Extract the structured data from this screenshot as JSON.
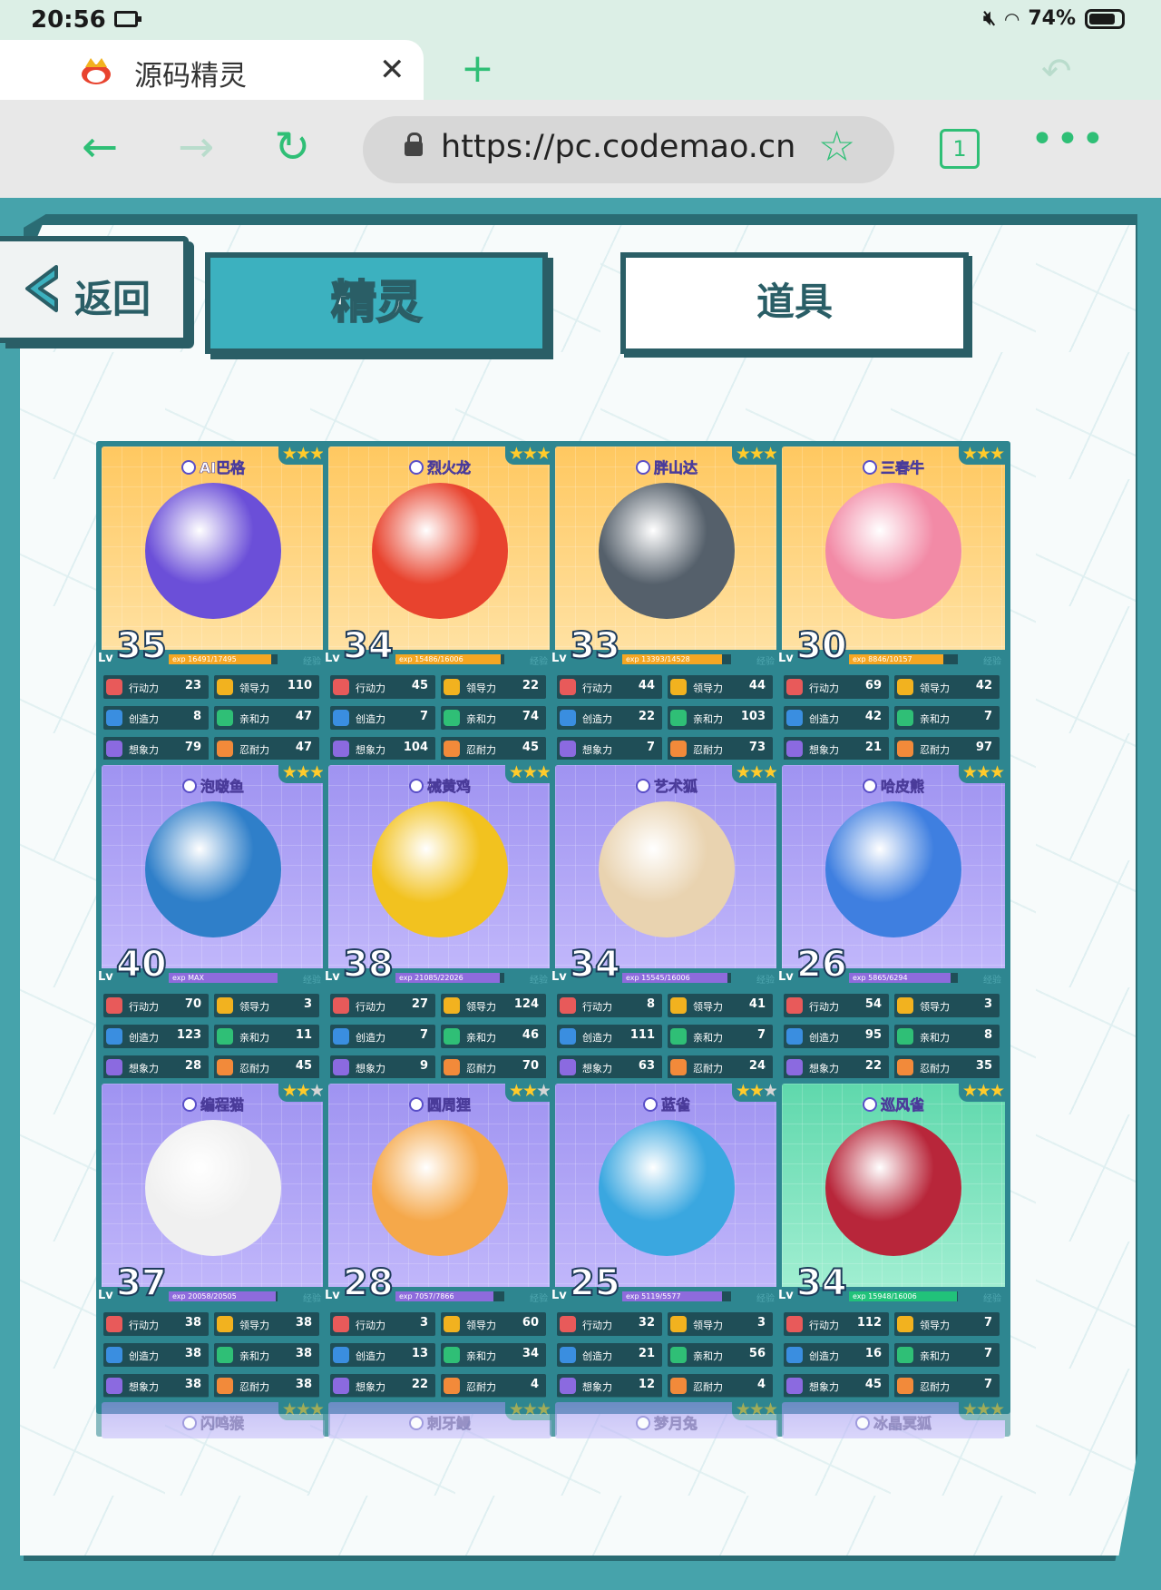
{
  "status_bar": {
    "time": "20:56",
    "battery": "74%"
  },
  "browser": {
    "tab_title": "源码精灵",
    "url": "https://pc.codemao.cn",
    "tab_count": "1"
  },
  "game": {
    "back_label": "返回",
    "tabs": [
      {
        "label": "精灵"
      },
      {
        "label": "道具"
      }
    ],
    "stat_labels": [
      "行动力",
      "领导力",
      "创造力",
      "亲和力",
      "想象力",
      "忍耐力"
    ],
    "exp_label": "经验",
    "lv_label": "Lv",
    "cards": [
      {
        "name": "AI巴格",
        "stars": 3,
        "bg": "orange",
        "level": "35",
        "exp": "exp 16491/17495",
        "exp_fill": 0.94,
        "stats": [
          "23",
          "110",
          "8",
          "47",
          "79",
          "47"
        ],
        "color": "#6b4fd8"
      },
      {
        "name": "烈火龙",
        "stars": 3,
        "bg": "orange",
        "level": "34",
        "exp": "exp 15486/16006",
        "exp_fill": 0.97,
        "stats": [
          "45",
          "22",
          "7",
          "74",
          "104",
          "45"
        ],
        "color": "#e8432e"
      },
      {
        "name": "胖山达",
        "stars": 3,
        "bg": "orange",
        "level": "33",
        "exp": "exp 13393/14528",
        "exp_fill": 0.92,
        "stats": [
          "44",
          "44",
          "22",
          "103",
          "7",
          "73"
        ],
        "color": "#55606b"
      },
      {
        "name": "三春牛",
        "stars": 3,
        "bg": "orange",
        "level": "30",
        "exp": "exp 8846/10157",
        "exp_fill": 0.87,
        "stats": [
          "69",
          "42",
          "42",
          "7",
          "21",
          "97"
        ],
        "color": "#f28aa6"
      },
      {
        "name": "泡啵鱼",
        "stars": 3,
        "bg": "purple",
        "level": "40",
        "exp": "exp MAX",
        "exp_fill": 1.0,
        "stats": [
          "70",
          "3",
          "123",
          "11",
          "28",
          "45"
        ],
        "color": "#2f7fc9"
      },
      {
        "name": "械黄鸡",
        "stars": 3,
        "bg": "purple",
        "level": "38",
        "exp": "exp 21085/22026",
        "exp_fill": 0.96,
        "stats": [
          "27",
          "124",
          "7",
          "46",
          "9",
          "70"
        ],
        "color": "#f2c21f"
      },
      {
        "name": "艺术狐",
        "stars": 3,
        "bg": "purple",
        "level": "34",
        "exp": "exp 15545/16006",
        "exp_fill": 0.97,
        "stats": [
          "8",
          "41",
          "111",
          "7",
          "63",
          "24"
        ],
        "color": "#e9d3b0"
      },
      {
        "name": "哈皮熊",
        "stars": 3,
        "bg": "purple",
        "level": "26",
        "exp": "exp 5865/6294",
        "exp_fill": 0.93,
        "stats": [
          "54",
          "3",
          "95",
          "8",
          "22",
          "35"
        ],
        "color": "#3f7fe0"
      },
      {
        "name": "编程猫",
        "stars": 2,
        "bg": "purple",
        "level": "37",
        "exp": "exp 20058/20505",
        "exp_fill": 0.98,
        "stats": [
          "38",
          "38",
          "38",
          "38",
          "38",
          "38"
        ],
        "color": "#f0f0f0"
      },
      {
        "name": "圆周狸",
        "stars": 2,
        "bg": "purple",
        "level": "28",
        "exp": "exp 7057/7866",
        "exp_fill": 0.9,
        "stats": [
          "3",
          "60",
          "13",
          "34",
          "22",
          "4"
        ],
        "color": "#f5a84a"
      },
      {
        "name": "蓝雀",
        "stars": 2,
        "bg": "purple",
        "level": "25",
        "exp": "exp 5119/5577",
        "exp_fill": 0.92,
        "stats": [
          "32",
          "3",
          "21",
          "56",
          "12",
          "4"
        ],
        "color": "#3aa7e0"
      },
      {
        "name": "巡风雀",
        "stars": 3,
        "bg": "green",
        "level": "34",
        "exp": "exp 15948/16006",
        "exp_fill": 0.99,
        "stats": [
          "112",
          "7",
          "16",
          "7",
          "45",
          "7"
        ],
        "color": "#b8263a"
      }
    ],
    "partial_cards": [
      {
        "name": "闪鸣猴",
        "stars": 3
      },
      {
        "name": "刺牙鳗",
        "stars": 3
      },
      {
        "name": "梦月兔",
        "stars": 3
      },
      {
        "name": "冰晶冥狐",
        "stars": 3
      }
    ]
  }
}
